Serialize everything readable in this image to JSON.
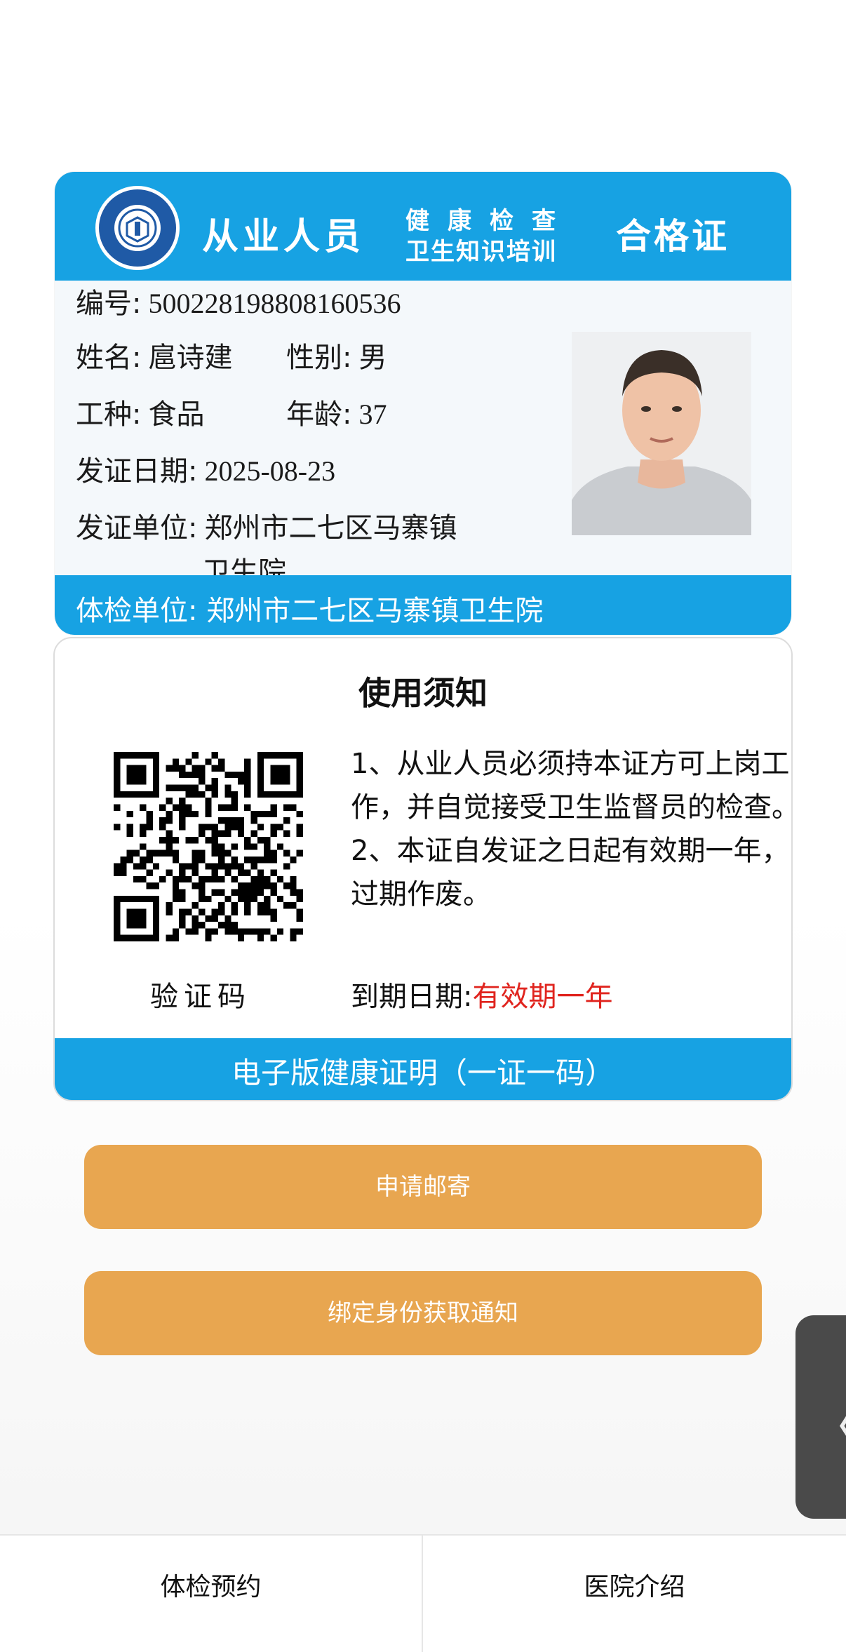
{
  "certificate": {
    "title_main": "从业人员",
    "title_sub_1": "健康检查",
    "title_sub_2": "卫生知识培训",
    "title_right": "合格证",
    "number_label": "编号:",
    "number_value": "500228198808160536",
    "name_label": "姓名:",
    "name_value": "扈诗建",
    "gender_label": "性别:",
    "gender_value": "男",
    "job_label": "工种:",
    "job_value": "食品",
    "age_label": "年龄:",
    "age_value": "37",
    "issue_date_label": "发证日期:",
    "issue_date_value": "2025-08-23",
    "issuer_label": "发证单位:",
    "issuer_value_line1": "郑州市二七区马寨镇",
    "issuer_value_line2": "卫生院",
    "exam_unit_label": "体检单位:",
    "exam_unit_value": "郑州市二七区马寨镇卫生院"
  },
  "notice": {
    "title": "使用须知",
    "rule_1": "1、从业人员必须持本证方可上岗工作，并自觉接受卫生监督员的检查。",
    "rule_2": "2、本证自发证之日起有效期一年，过期作废。",
    "verify_label": "验证码",
    "expire_label": "到期日期:",
    "expire_value": "有效期一年",
    "footer": "电子版健康证明（一证一码）"
  },
  "buttons": {
    "mail_label": "申请邮寄",
    "bind_label": "绑定身份获取通知"
  },
  "side_tab": {
    "icon": "chevron-left-icon",
    "glyph": "〈"
  },
  "bottom_nav": {
    "left_label": "体检预约",
    "right_label": "医院介绍"
  },
  "colors": {
    "header_blue": "#17a2e3",
    "button_orange": "#e8a650",
    "expire_red": "#e0241e"
  }
}
